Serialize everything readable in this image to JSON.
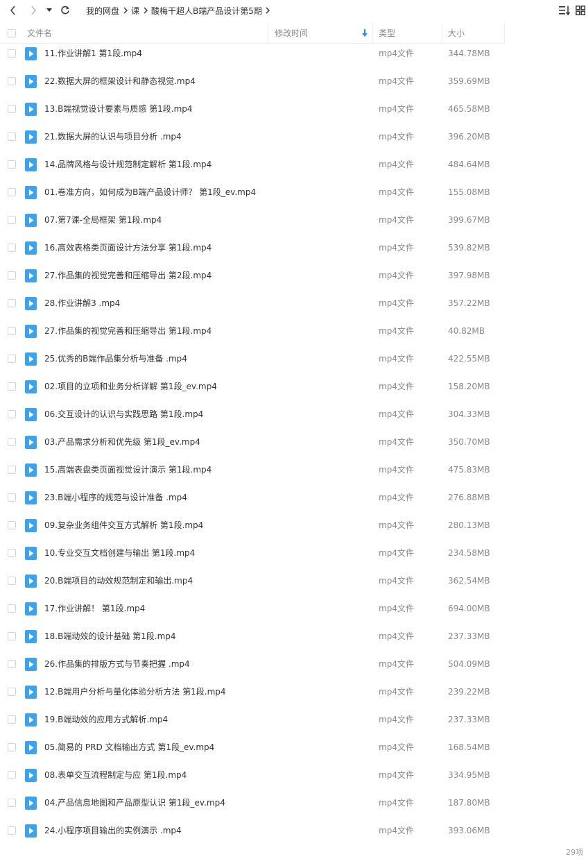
{
  "breadcrumb": {
    "items": [
      "我的网盘",
      "课",
      "酸梅干超人B端产品设计第5期"
    ]
  },
  "columns": {
    "name": "文件名",
    "modified": "修改时间",
    "type": "类型",
    "size": "大小"
  },
  "colors": {
    "accent": "#1e90ff",
    "file_icon": "#3ba4f2",
    "text": "#333333",
    "muted": "#888888"
  },
  "files": [
    {
      "name": "11.作业讲解1 第1段.mp4",
      "type": "mp4文件",
      "size": "344.78MB"
    },
    {
      "name": "22.数据大屏的框架设计和静态视觉.mp4",
      "type": "mp4文件",
      "size": "359.69MB"
    },
    {
      "name": "13.B端视觉设计要素与质感 第1段.mp4",
      "type": "mp4文件",
      "size": "465.58MB"
    },
    {
      "name": "21.数据大屏的认识与项目分析 .mp4",
      "type": "mp4文件",
      "size": "396.20MB"
    },
    {
      "name": "14.品牌风格与设计规范制定解析 第1段.mp4",
      "type": "mp4文件",
      "size": "484.64MB"
    },
    {
      "name": "01.卷准方向，如何成为B端产品设计师？ 第1段_ev.mp4",
      "type": "mp4文件",
      "size": "155.08MB"
    },
    {
      "name": "07.第7课-全局框架 第1段.mp4",
      "type": "mp4文件",
      "size": "399.67MB"
    },
    {
      "name": "16.高效表格类页面设计方法分享 第1段.mp4",
      "type": "mp4文件",
      "size": "539.82MB"
    },
    {
      "name": "27.作品集的视觉完善和压缩导出 第2段.mp4",
      "type": "mp4文件",
      "size": "397.98MB"
    },
    {
      "name": "28.作业讲解3 .mp4",
      "type": "mp4文件",
      "size": "357.22MB"
    },
    {
      "name": "27.作品集的视觉完善和压缩导出 第1段.mp4",
      "type": "mp4文件",
      "size": "40.82MB"
    },
    {
      "name": "25.优秀的B端作品集分析与准备 .mp4",
      "type": "mp4文件",
      "size": "422.55MB"
    },
    {
      "name": "02.项目的立项和业务分析详解 第1段_ev.mp4",
      "type": "mp4文件",
      "size": "158.20MB"
    },
    {
      "name": "06.交互设计的认识与实践思路 第1段.mp4",
      "type": "mp4文件",
      "size": "304.33MB"
    },
    {
      "name": "03.产品需求分析和优先级 第1段_ev.mp4",
      "type": "mp4文件",
      "size": "350.70MB"
    },
    {
      "name": "15.高端表盘类页面视觉设计演示 第1段.mp4",
      "type": "mp4文件",
      "size": "475.83MB"
    },
    {
      "name": "23.B端小程序的规范与设计准备 .mp4",
      "type": "mp4文件",
      "size": "276.88MB"
    },
    {
      "name": "09.复杂业务组件交互方式解析 第1段.mp4",
      "type": "mp4文件",
      "size": "280.13MB"
    },
    {
      "name": "10.专业交互文档创建与输出 第1段.mp4",
      "type": "mp4文件",
      "size": "234.58MB"
    },
    {
      "name": "20.B端项目的动效规范制定和输出.mp4",
      "type": "mp4文件",
      "size": "362.54MB"
    },
    {
      "name": "17.作业讲解！ 第1段.mp4",
      "type": "mp4文件",
      "size": "694.00MB"
    },
    {
      "name": "18.B端动效的设计基础 第1段.mp4",
      "type": "mp4文件",
      "size": "237.33MB"
    },
    {
      "name": "26.作品集的排版方式与节奏把握 .mp4",
      "type": "mp4文件",
      "size": "504.09MB"
    },
    {
      "name": "12.B端用户分析与量化体验分析方法 第1段.mp4",
      "type": "mp4文件",
      "size": "239.22MB"
    },
    {
      "name": "19.B端动效的应用方式解析.mp4",
      "type": "mp4文件",
      "size": "237.33MB"
    },
    {
      "name": "05.简易的 PRD 文档输出方式 第1段_ev.mp4",
      "type": "mp4文件",
      "size": "168.54MB"
    },
    {
      "name": "08.表单交互流程制定与应 第1段.mp4",
      "type": "mp4文件",
      "size": "334.95MB"
    },
    {
      "name": "04.产品信息地图和产品原型认识 第1段_ev.mp4",
      "type": "mp4文件",
      "size": "187.80MB"
    },
    {
      "name": "24.小程序项目输出的实例演示 .mp4",
      "type": "mp4文件",
      "size": "393.06MB"
    }
  ],
  "footer": {
    "item_count": "29项"
  }
}
